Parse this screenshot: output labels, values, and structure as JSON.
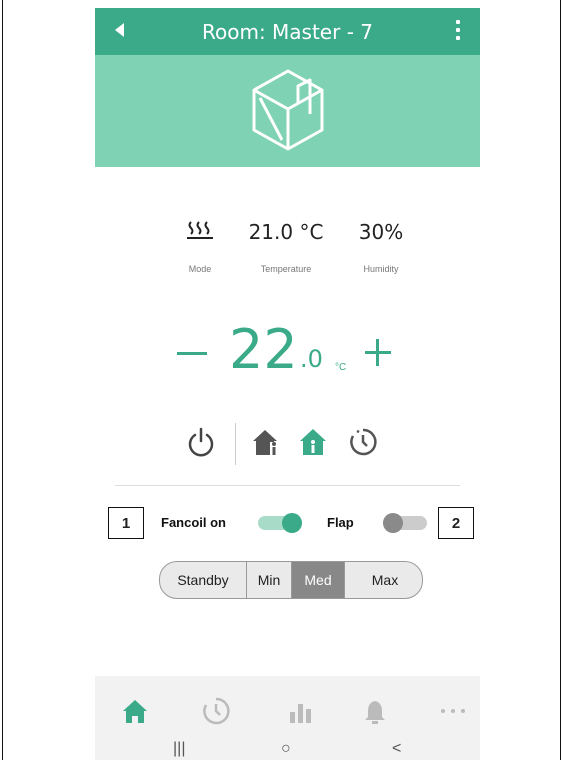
{
  "app": {
    "title": "Room: Master - 7",
    "accent_color": "#3aaa88",
    "hero_color": "#7fd2b4"
  },
  "stats": {
    "mode": {
      "icon": "heating-waves-icon",
      "label": "Mode"
    },
    "temperature": {
      "value": "21.0 °C",
      "label": "Temperature"
    },
    "humidity": {
      "value": "30%",
      "label": "Humidity"
    }
  },
  "setpoint": {
    "integer": "22",
    "decimal": ".0",
    "unit": "°C"
  },
  "mode_buttons": [
    {
      "name": "power-icon"
    },
    {
      "name": "home-away-icon"
    },
    {
      "name": "home-icon",
      "active": true
    },
    {
      "name": "schedule-icon"
    }
  ],
  "controls": {
    "fancoil_label": "Fancoil on",
    "fancoil_on": true,
    "flap_label": "Flap",
    "flap_on": false,
    "callout_1": "1",
    "callout_2": "2"
  },
  "fan_speed": {
    "options": [
      "Standby",
      "Min",
      "Med",
      "Max"
    ],
    "selected": "Med"
  },
  "bottom_nav": [
    {
      "icon": "home-icon",
      "active": true
    },
    {
      "icon": "schedule-icon"
    },
    {
      "icon": "bar-chart-icon"
    },
    {
      "icon": "bell-icon"
    },
    {
      "icon": "more-icon"
    }
  ],
  "system_nav": [
    "|||",
    "○",
    "<"
  ]
}
